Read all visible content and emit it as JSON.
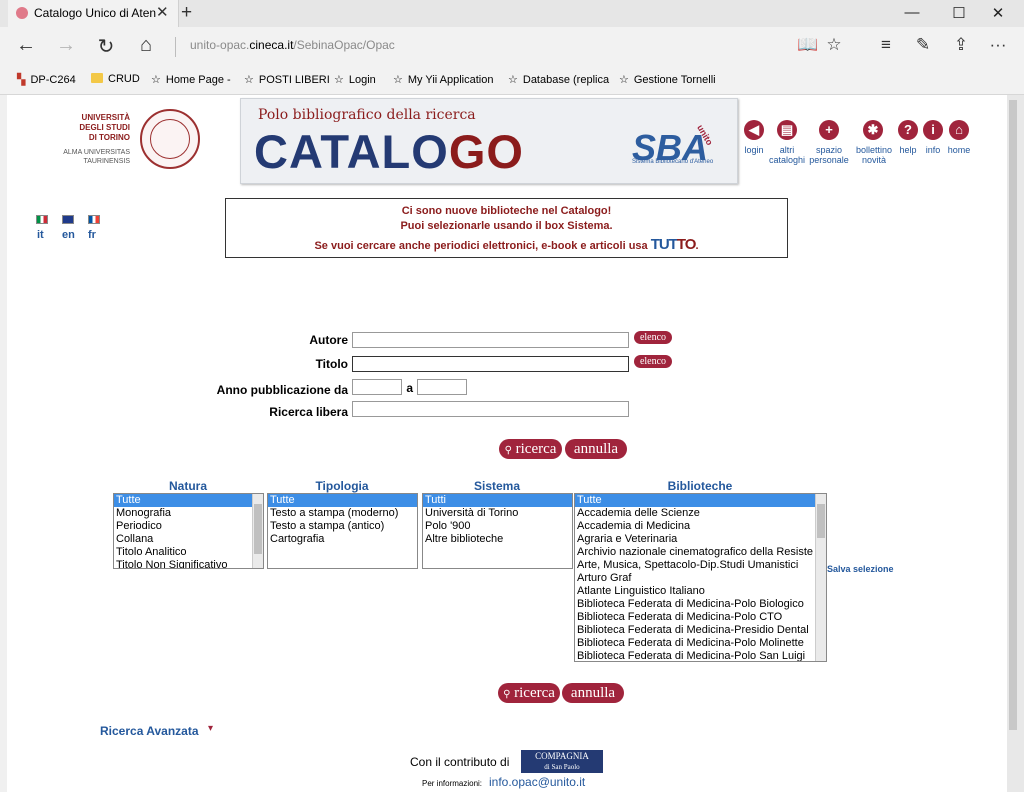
{
  "browser": {
    "tab_title": "Catalogo Unico di Atene",
    "tab_close": "✕",
    "new_tab": "+",
    "minimize": "—",
    "maximize": "☐",
    "close": "✕",
    "back": "←",
    "forward": "→",
    "refresh": "↻",
    "home": "⌂",
    "url_prefix": "unito-opac.",
    "url_host": "cineca.it",
    "url_path": "/SebinaOpac/Opac",
    "reading": "📖",
    "favorite": "☆",
    "hub": "≡",
    "notes": "✎",
    "share": "⇪",
    "more": "···"
  },
  "favorites": [
    {
      "label": "DP-C264",
      "icon": "site-icon"
    },
    {
      "label": "CRUD",
      "icon": "folder-icon"
    },
    {
      "label": "Home Page -",
      "icon": "star-icon"
    },
    {
      "label": "POSTI LIBERI",
      "icon": "star-icon"
    },
    {
      "label": "Login",
      "icon": "star-icon"
    },
    {
      "label": "My Yii Application",
      "icon": "star-icon"
    },
    {
      "label": "Database (replica",
      "icon": "star-icon"
    },
    {
      "label": "Gestione Tornelli",
      "icon": "star-icon"
    }
  ],
  "logo": {
    "unito_line1": "UNIVERSITÀ",
    "unito_line2": "DEGLI STUDI",
    "unito_line3": "DI TORINO",
    "unito_sub1": "ALMA UNIVERSITAS",
    "unito_sub2": "TAURINENSIS"
  },
  "banner": {
    "subtitle": "Polo bibliografico della ricerca",
    "title_a": "CATALO",
    "title_b": "G",
    "title_c": "O",
    "sba": "SBA",
    "sba_sub": "Sistema Bibliotecario d'Ateneo",
    "sba_badge": "unito"
  },
  "top_links": [
    {
      "label1": "login",
      "label2": "",
      "glyph": "◀"
    },
    {
      "label1": "altri",
      "label2": "cataloghi",
      "glyph": "▤"
    },
    {
      "label1": "spazio",
      "label2": "personale",
      "glyph": "+"
    },
    {
      "label1": "bollettino",
      "label2": "novità",
      "glyph": "✱"
    },
    {
      "label1": "help",
      "label2": "",
      "glyph": "?"
    },
    {
      "label1": "info",
      "label2": "",
      "glyph": "i"
    },
    {
      "label1": "home",
      "label2": "",
      "glyph": "⌂"
    }
  ],
  "languages": [
    {
      "code": "it"
    },
    {
      "code": "en"
    },
    {
      "code": "fr"
    }
  ],
  "notice": {
    "line1": "Ci sono nuove biblioteche nel Catalogo!",
    "line2": "Puoi selezionarle usando il box Sistema.",
    "line3": "Se vuoi cercare anche periodici elettronici, e-book e articoli usa",
    "tutto_a": "TUT",
    "tutto_b": "TO",
    "end": "."
  },
  "form": {
    "autore_label": "Autore",
    "titolo_label": "Titolo",
    "anno_label": "Anno pubblicazione da",
    "anno_a": "a",
    "libera_label": "Ricerca libera",
    "elenco": "elenco",
    "autore_value": "",
    "titolo_value": "",
    "anno_da": "",
    "anno_a_value": "",
    "libera_value": "",
    "ricerca": "ricerca",
    "annulla": "annulla",
    "search_glyph": "🔍"
  },
  "lists": {
    "natura": {
      "header": "Natura",
      "options": [
        "Tutte",
        "Monografia",
        "Periodico",
        "Collana",
        "Titolo Analitico",
        "Titolo Non Significativo"
      ]
    },
    "tipologia": {
      "header": "Tipologia",
      "options": [
        "Tutte",
        "Testo a stampa (moderno)",
        "Testo a stampa (antico)",
        "Cartografia"
      ]
    },
    "sistema": {
      "header": "Sistema",
      "options": [
        "Tutti",
        "Università di Torino",
        "Polo '900",
        "Altre biblioteche"
      ]
    },
    "biblioteche": {
      "header": "Biblioteche",
      "options": [
        "Tutte",
        "Accademia delle Scienze",
        "Accademia di Medicina",
        "Agraria e Veterinaria",
        "Archivio nazionale cinematografico della Resiste",
        "Arte, Musica, Spettacolo-Dip.Studi Umanistici",
        "Arturo Graf",
        "Atlante Linguistico Italiano",
        "Biblioteca Federata di Medicina-Polo Biologico",
        "Biblioteca Federata di Medicina-Polo CTO",
        "Biblioteca Federata di Medicina-Presidio Dental",
        "Biblioteca Federata di Medicina-Polo Molinette",
        "Biblioteca Federata di Medicina-Polo San Luigi"
      ]
    },
    "salva": "Salva selezione"
  },
  "footer": {
    "avanzata": "Ricerca Avanzata",
    "avanzata_arrow": "▾",
    "contributo": "Con il contributo di",
    "compagnia1": "COMPAGNIA",
    "compagnia2": "di San Paolo",
    "info_label": "Per informazioni:",
    "info_mail": "info.opac@unito.it"
  }
}
